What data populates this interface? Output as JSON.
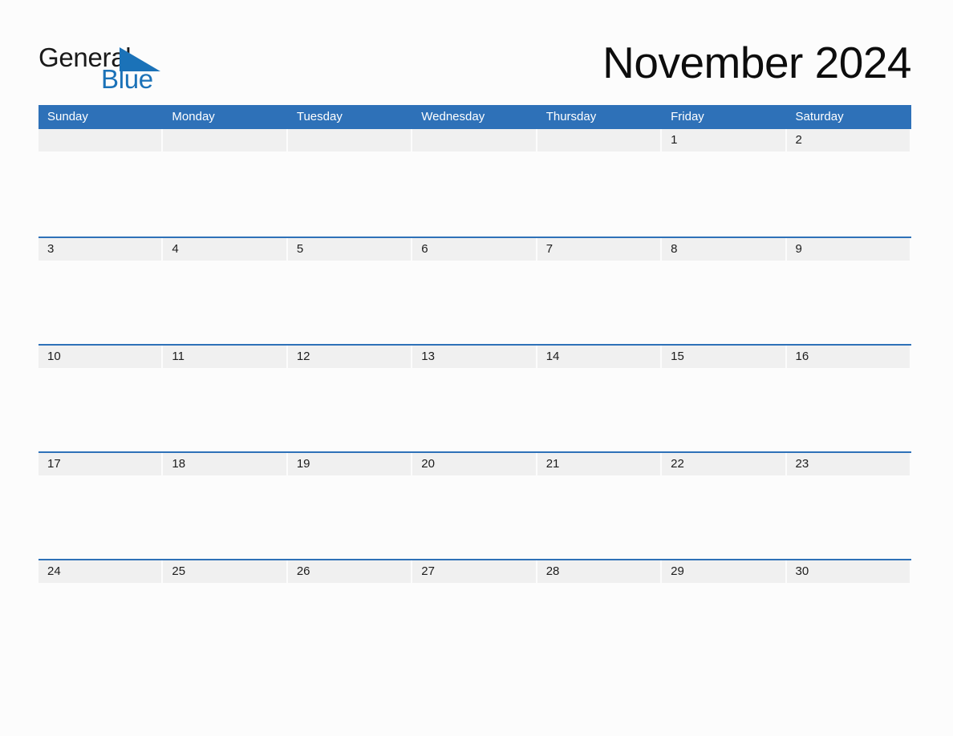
{
  "brand": {
    "name_part_one": "General",
    "name_part_two": "Blue",
    "triangle_icon": "blue-triangle-icon",
    "black_hex": "#1a1a1a",
    "blue_hex": "#1b72b8"
  },
  "header": {
    "title": "November 2024",
    "month": "November",
    "year": "2024"
  },
  "theme": {
    "accent_hex": "#2e71b8",
    "date_band_hex": "#f0f0f0",
    "page_background_hex": "#fcfcfc",
    "weekday_text_hex": "#ffffff",
    "date_text_hex": "#1c1c1c"
  },
  "calendar": {
    "weekdays": [
      "Sunday",
      "Monday",
      "Tuesday",
      "Wednesday",
      "Thursday",
      "Friday",
      "Saturday"
    ],
    "weeks": [
      [
        {
          "day": ""
        },
        {
          "day": ""
        },
        {
          "day": ""
        },
        {
          "day": ""
        },
        {
          "day": ""
        },
        {
          "day": "1"
        },
        {
          "day": "2"
        }
      ],
      [
        {
          "day": "3"
        },
        {
          "day": "4"
        },
        {
          "day": "5"
        },
        {
          "day": "6"
        },
        {
          "day": "7"
        },
        {
          "day": "8"
        },
        {
          "day": "9"
        }
      ],
      [
        {
          "day": "10"
        },
        {
          "day": "11"
        },
        {
          "day": "12"
        },
        {
          "day": "13"
        },
        {
          "day": "14"
        },
        {
          "day": "15"
        },
        {
          "day": "16"
        }
      ],
      [
        {
          "day": "17"
        },
        {
          "day": "18"
        },
        {
          "day": "19"
        },
        {
          "day": "20"
        },
        {
          "day": "21"
        },
        {
          "day": "22"
        },
        {
          "day": "23"
        }
      ],
      [
        {
          "day": "24"
        },
        {
          "day": "25"
        },
        {
          "day": "26"
        },
        {
          "day": "27"
        },
        {
          "day": "28"
        },
        {
          "day": "29"
        },
        {
          "day": "30"
        }
      ]
    ]
  }
}
